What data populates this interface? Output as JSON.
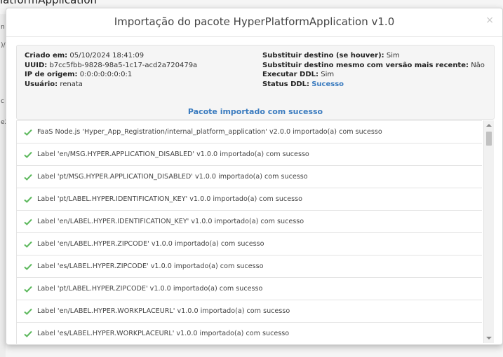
{
  "background": {
    "title_fragment": "latformApplication",
    "side_fragments": [
      "n",
      ")/",
      "c",
      "e2"
    ]
  },
  "modal": {
    "title": "Importação do pacote HyperPlatformApplication v1.0",
    "close_glyph": "×"
  },
  "info": {
    "created_label": "Criado em:",
    "created_value": "05/10/2024 18:41:09",
    "uuid_label": "UUID:",
    "uuid_value": "b7cc5fbb-9828-98a5-1c17-acd2a720479a",
    "ip_label": "IP de origem:",
    "ip_value": "0:0:0:0:0:0:0:1",
    "user_label": "Usuário:",
    "user_value": "renata",
    "replace_label": "Substituir destino (se houver):",
    "replace_value": "Sim",
    "replace_same_label": "Substituir destino mesmo com versão mais recente:",
    "replace_same_value": "Não",
    "ddl_label": "Executar DDL:",
    "ddl_value": "Sim",
    "ddl_status_label": "Status DDL:",
    "ddl_status_value": "Sucesso",
    "result_message": "Pacote importado com sucesso"
  },
  "log_items": [
    "FaaS Node.js 'Hyper_App_Registration/internal_platform_application' v2.0.0 importado(a) com sucesso",
    "Label 'en/MSG.HYPER.APPLICATION_DISABLED' v1.0.0 importado(a) com sucesso",
    "Label 'pt/MSG.HYPER.APPLICATION_DISABLED' v1.0.0 importado(a) com sucesso",
    "Label 'pt/LABEL.HYPER.IDENTIFICATION_KEY' v1.0.0 importado(a) com sucesso",
    "Label 'en/LABEL.HYPER.IDENTIFICATION_KEY' v1.0.0 importado(a) com sucesso",
    "Label 'en/LABEL.HYPER.ZIPCODE' v1.0.0 importado(a) com sucesso",
    "Label 'es/LABEL.HYPER.ZIPCODE' v1.0.0 importado(a) com sucesso",
    "Label 'pt/LABEL.HYPER.ZIPCODE' v1.0.0 importado(a) com sucesso",
    "Label 'en/LABEL.HYPER.WORKPLACEURL' v1.0.0 importado(a) com sucesso",
    "Label 'es/LABEL.HYPER.WORKPLACEURL' v1.0.0 importado(a) com sucesso"
  ],
  "colors": {
    "success_check": "#5cb85c",
    "accent_blue": "#3a7bbf"
  },
  "icons": {
    "log_item": "check-icon",
    "close": "close-icon"
  }
}
